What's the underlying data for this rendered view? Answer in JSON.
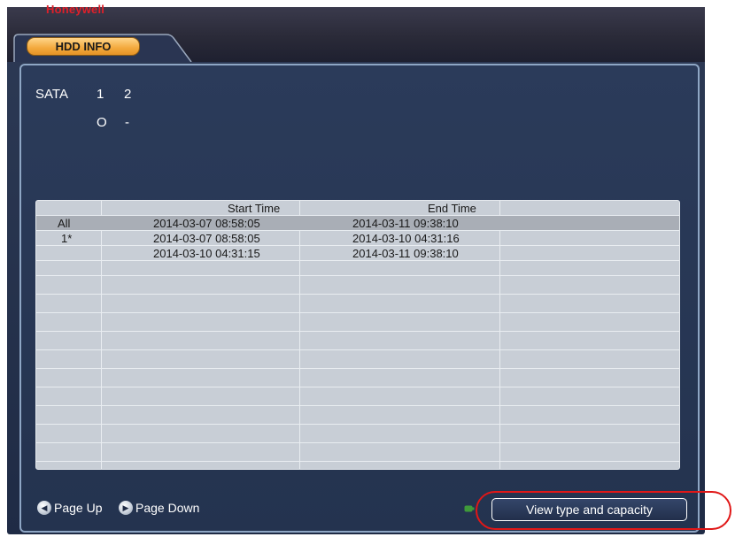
{
  "app": {
    "brand": "Honeywell"
  },
  "tab": {
    "label": "HDD INFO"
  },
  "sata": {
    "label": "SATA",
    "numbers": [
      "1",
      "2"
    ],
    "status": [
      "O",
      "-"
    ]
  },
  "table": {
    "headers": {
      "start": "Start Time",
      "end": "End Time"
    },
    "rows": [
      {
        "label": "All",
        "start": "2014-03-07 08:58:05",
        "end": "2014-03-11 09:38:10",
        "selected": true
      },
      {
        "label": "1*",
        "start": "2014-03-07 08:58:05",
        "end": "2014-03-10 04:31:16",
        "selected": false
      },
      {
        "label": "",
        "start": "2014-03-10 04:31:15",
        "end": "2014-03-11 09:38:10",
        "selected": false
      }
    ]
  },
  "footer": {
    "page_up_label": "Page Up",
    "page_down_label": "Page Down",
    "view_button_label": "View type and capacity",
    "fn_icon": "fn-key-icon",
    "page_up_icon": "page-up-icon",
    "page_down_icon": "page-down-icon"
  },
  "colors": {
    "brand": "#e0202a",
    "tab_accent": "#f3a93c",
    "highlight": "#e01717",
    "panel": "#24334f"
  }
}
